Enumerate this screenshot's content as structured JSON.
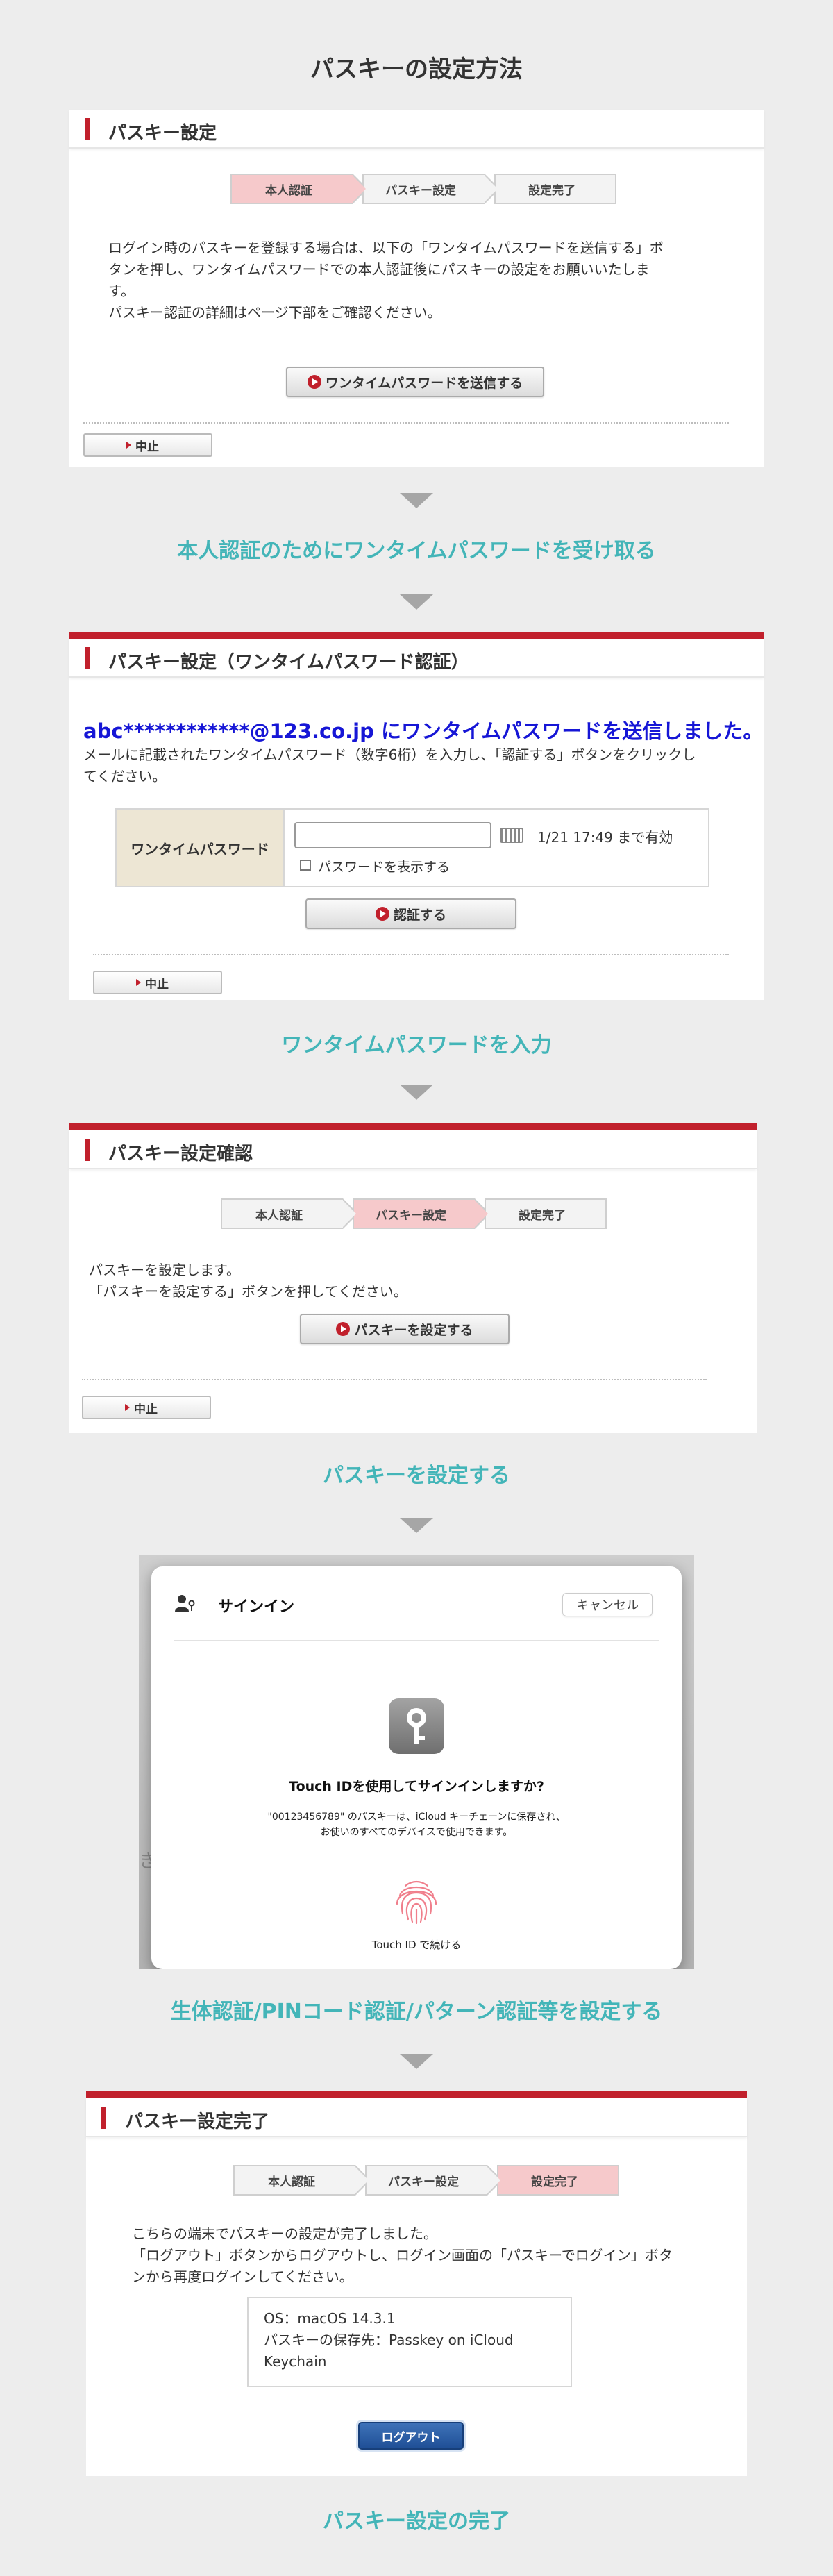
{
  "page": {
    "title": "パスキーの設定方法"
  },
  "common": {
    "cancel_label": "中止"
  },
  "steps_labels": [
    "本人認証",
    "パスキー設定",
    "設定完了"
  ],
  "section1": {
    "header": "パスキー設定",
    "body_lines": [
      "ログイン時のパスキーを登録する場合は、以下の「ワンタイムパスワードを送信する」ボ",
      "タンを押し、ワンタイムパスワードでの本人認証後にパスキーの設定をお願いいたしま",
      "す。",
      "パスキー認証の詳細はページ下部をご確認ください。"
    ],
    "button": "ワンタイムパスワードを送信する",
    "caption": "本人認証のためにワンタイムパスワードを受け取る"
  },
  "section2": {
    "header": "パスキー設定（ワンタイムパスワード認証）",
    "sent_title": "abc************@123.co.jp にワンタイムパスワードを送信しました。",
    "body_lines": [
      "メールに記載されたワンタイムパスワード（数字6桁）を入力し、「認証する」ボタンをクリックし",
      "てください。"
    ],
    "otp_label": "ワンタイムパスワード",
    "otp_value": "",
    "expiry": "1/21 17:49 まで有効",
    "show_password": "パスワードを表示する",
    "button": "認証する",
    "caption": "ワンタイムパスワードを入力"
  },
  "section3": {
    "header": "パスキー設定確認",
    "body_lines": [
      "パスキーを設定します。",
      "「パスキーを設定する」ボタンを押してください。"
    ],
    "button": "パスキーを設定する",
    "caption": "パスキーを設定する"
  },
  "section4": {
    "sign_in": "サインイン",
    "cancel": "キャンセル",
    "question": "Touch IDを使用してサインインしますか?",
    "note_line1": "\"00123456789\" のパスキーは、iCloud キーチェーンに保存され、",
    "note_line2": "お使いのすべてのデバイスで使用できます。",
    "continue": "Touch ID で続ける",
    "bg_char": "き",
    "caption": "生体認証/PINコード認証/パターン認証等を設定する"
  },
  "section5": {
    "header": "パスキー設定完了",
    "body_lines": [
      "こちらの端末でパスキーの設定が完了しました。",
      "「ログアウト」ボタンからログアウトし、ログイン画面の「パスキーでログイン」ボタ",
      "ンから再度ログインしてください。"
    ],
    "info_lines": [
      "OS：macOS 14.3.1",
      "パスキーの保存先：Passkey on iCloud",
      "Keychain"
    ],
    "logout": "ログアウト",
    "caption": "パスキー設定の完了"
  },
  "colors": {
    "accent_red": "#c1202c",
    "caption_teal": "#43b5b8",
    "step_active": "#f6c9cb",
    "sent_blue": "#1616d6",
    "logout_blue": "#2b5ea8"
  }
}
